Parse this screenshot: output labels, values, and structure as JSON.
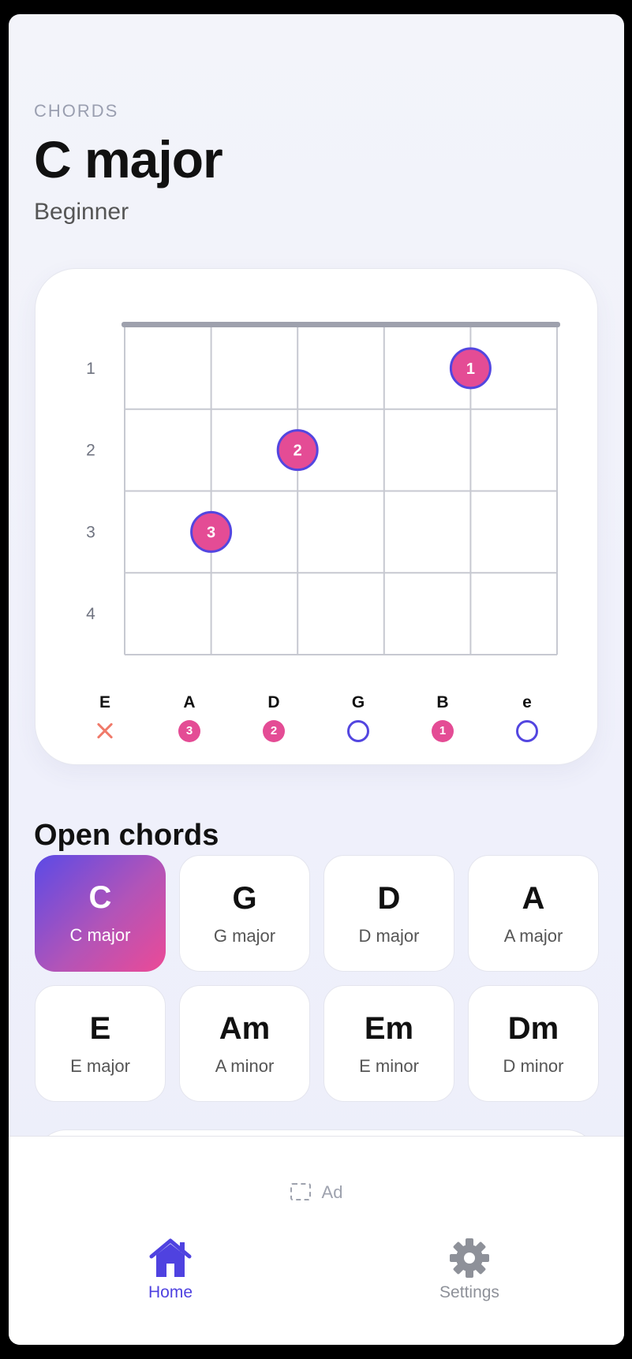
{
  "header": {
    "eyebrow": "CHORDS",
    "title": "C major",
    "subtitle": "Beginner"
  },
  "diagram": {
    "fret_numbers": [
      "1",
      "2",
      "3",
      "4"
    ],
    "fingers": [
      {
        "string_index": 4,
        "fret": 1,
        "label": "1"
      },
      {
        "string_index": 2,
        "fret": 2,
        "label": "2"
      },
      {
        "string_index": 1,
        "fret": 3,
        "label": "3"
      }
    ],
    "strings": [
      {
        "name": "E",
        "state": "mute",
        "label": ""
      },
      {
        "name": "A",
        "state": "finger",
        "label": "3"
      },
      {
        "name": "D",
        "state": "finger",
        "label": "2"
      },
      {
        "name": "G",
        "state": "open",
        "label": ""
      },
      {
        "name": "B",
        "state": "finger",
        "label": "1"
      },
      {
        "name": "e",
        "state": "open",
        "label": ""
      }
    ],
    "colors": {
      "finger": "#e44c95",
      "ring": "#5346e0",
      "mute": "#f07a6a",
      "nut": "#9ea1ad",
      "grid": "#c7c9d1"
    }
  },
  "section": {
    "title": "Open chords"
  },
  "chords": [
    {
      "symbol": "C",
      "name": "C major",
      "active": true
    },
    {
      "symbol": "G",
      "name": "G major",
      "active": false
    },
    {
      "symbol": "D",
      "name": "D major",
      "active": false
    },
    {
      "symbol": "A",
      "name": "A major",
      "active": false
    },
    {
      "symbol": "E",
      "name": "E major",
      "active": false
    },
    {
      "symbol": "Am",
      "name": "A minor",
      "active": false
    },
    {
      "symbol": "Em",
      "name": "E minor",
      "active": false
    },
    {
      "symbol": "Dm",
      "name": "D minor",
      "active": false
    }
  ],
  "ad": {
    "label": "Ad",
    "icon": "ad-placeholder-icon"
  },
  "nav": {
    "home": {
      "label": "Home",
      "icon": "home-icon",
      "active": true
    },
    "settings": {
      "label": "Settings",
      "icon": "gear-icon",
      "active": false
    }
  }
}
